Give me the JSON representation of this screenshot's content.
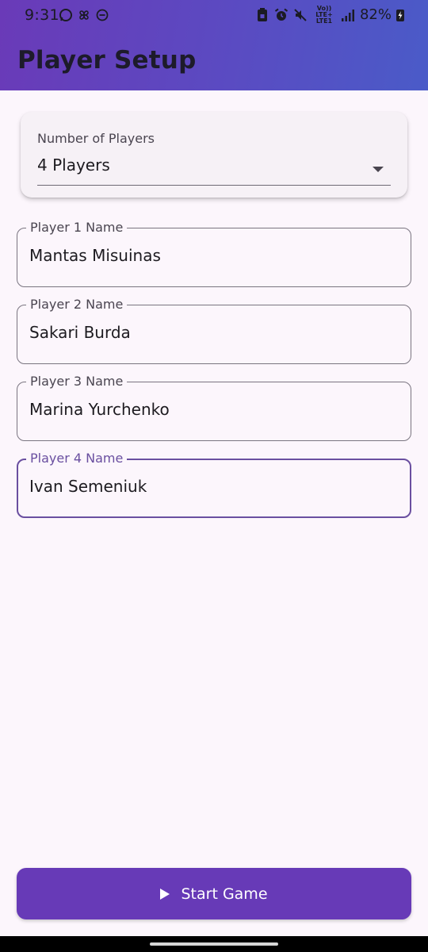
{
  "status_bar": {
    "time": "9:31",
    "left_icons": [
      "whatsapp-icon",
      "pinwheel-icon",
      "dnd-minus-icon"
    ],
    "right_icons": [
      "lock-battery-icon",
      "alarm-icon",
      "mute-icon",
      "volte-icon",
      "signal-icon",
      "battery-charging-icon"
    ],
    "net_line1": "Vo)) LTE+",
    "net_line2": "LTE1",
    "battery": "82%"
  },
  "app_bar": {
    "title": "Player Setup"
  },
  "players_select": {
    "label": "Number of Players",
    "value": "4 Players"
  },
  "players": [
    {
      "label": "Player 1 Name",
      "value": "Mantas Misuinas",
      "focused": false
    },
    {
      "label": "Player 2 Name",
      "value": "Sakari Burda",
      "focused": false
    },
    {
      "label": "Player 3 Name",
      "value": "Marina Yurchenko",
      "focused": false
    },
    {
      "label": "Player 4 Name",
      "value": "Ivan Semeniuk",
      "focused": true
    }
  ],
  "start_button": {
    "label": "Start Game"
  },
  "colors": {
    "primary": "#673ab7",
    "focus_outline": "#6a4fa0",
    "background": "#fcf6fc",
    "header_gradient_start": "#6a3ab8",
    "header_gradient_end": "#4a5bc8"
  }
}
